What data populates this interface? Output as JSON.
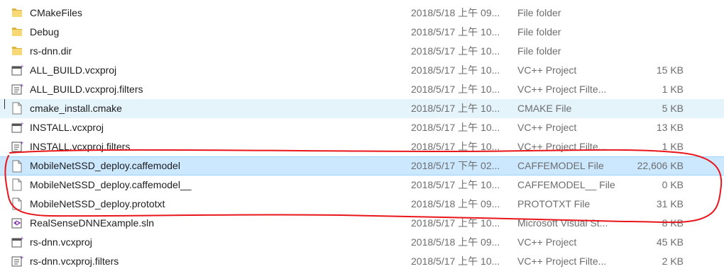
{
  "files": [
    {
      "name": "CMakeFiles",
      "date": "2018/5/18 上午 09...",
      "type": "File folder",
      "size": "",
      "icon": "folder-icon",
      "state": ""
    },
    {
      "name": "Debug",
      "date": "2018/5/17 上午 10...",
      "type": "File folder",
      "size": "",
      "icon": "folder-icon",
      "state": ""
    },
    {
      "name": "rs-dnn.dir",
      "date": "2018/5/17 上午 10...",
      "type": "File folder",
      "size": "",
      "icon": "folder-icon",
      "state": ""
    },
    {
      "name": "ALL_BUILD.vcxproj",
      "date": "2018/5/17 上午 10...",
      "type": "VC++ Project",
      "size": "15 KB",
      "icon": "vcxproj-icon",
      "state": ""
    },
    {
      "name": "ALL_BUILD.vcxproj.filters",
      "date": "2018/5/17 上午 10...",
      "type": "VC++ Project Filte...",
      "size": "1 KB",
      "icon": "filters-icon",
      "state": ""
    },
    {
      "name": "cmake_install.cmake",
      "date": "2018/5/17 上午 10...",
      "type": "CMAKE File",
      "size": "5 KB",
      "icon": "file-icon",
      "state": "hover"
    },
    {
      "name": "INSTALL.vcxproj",
      "date": "2018/5/17 上午 10...",
      "type": "VC++ Project",
      "size": "13 KB",
      "icon": "vcxproj-icon",
      "state": ""
    },
    {
      "name": "INSTALL.vcxproj.filters",
      "date": "2018/5/17 上午 10...",
      "type": "VC++ Project Filte...",
      "size": "1 KB",
      "icon": "filters-icon",
      "state": ""
    },
    {
      "name": "MobileNetSSD_deploy.caffemodel",
      "date": "2018/5/17 下午 02...",
      "type": "CAFFEMODEL File",
      "size": "22,606 KB",
      "icon": "file-icon",
      "state": "selected"
    },
    {
      "name": "MobileNetSSD_deploy.caffemodel__",
      "date": "2018/5/17 上午 10...",
      "type": "CAFFEMODEL__ File",
      "size": "0 KB",
      "icon": "file-icon",
      "state": ""
    },
    {
      "name": "MobileNetSSD_deploy.prototxt",
      "date": "2018/5/18 上午 09...",
      "type": "PROTOTXT File",
      "size": "31 KB",
      "icon": "file-icon",
      "state": ""
    },
    {
      "name": "RealSenseDNNExample.sln",
      "date": "2018/5/17 上午 10...",
      "type": "Microsoft Visual St...",
      "size": "8 KB",
      "icon": "sln-icon",
      "state": ""
    },
    {
      "name": "rs-dnn.vcxproj",
      "date": "2018/5/18 上午 09...",
      "type": "VC++ Project",
      "size": "45 KB",
      "icon": "vcxproj-icon",
      "state": ""
    },
    {
      "name": "rs-dnn.vcxproj.filters",
      "date": "2018/5/17 上午 10...",
      "type": "VC++ Project Filte...",
      "size": "2 KB",
      "icon": "filters-icon",
      "state": ""
    }
  ],
  "annotation_color": "#e8161b"
}
